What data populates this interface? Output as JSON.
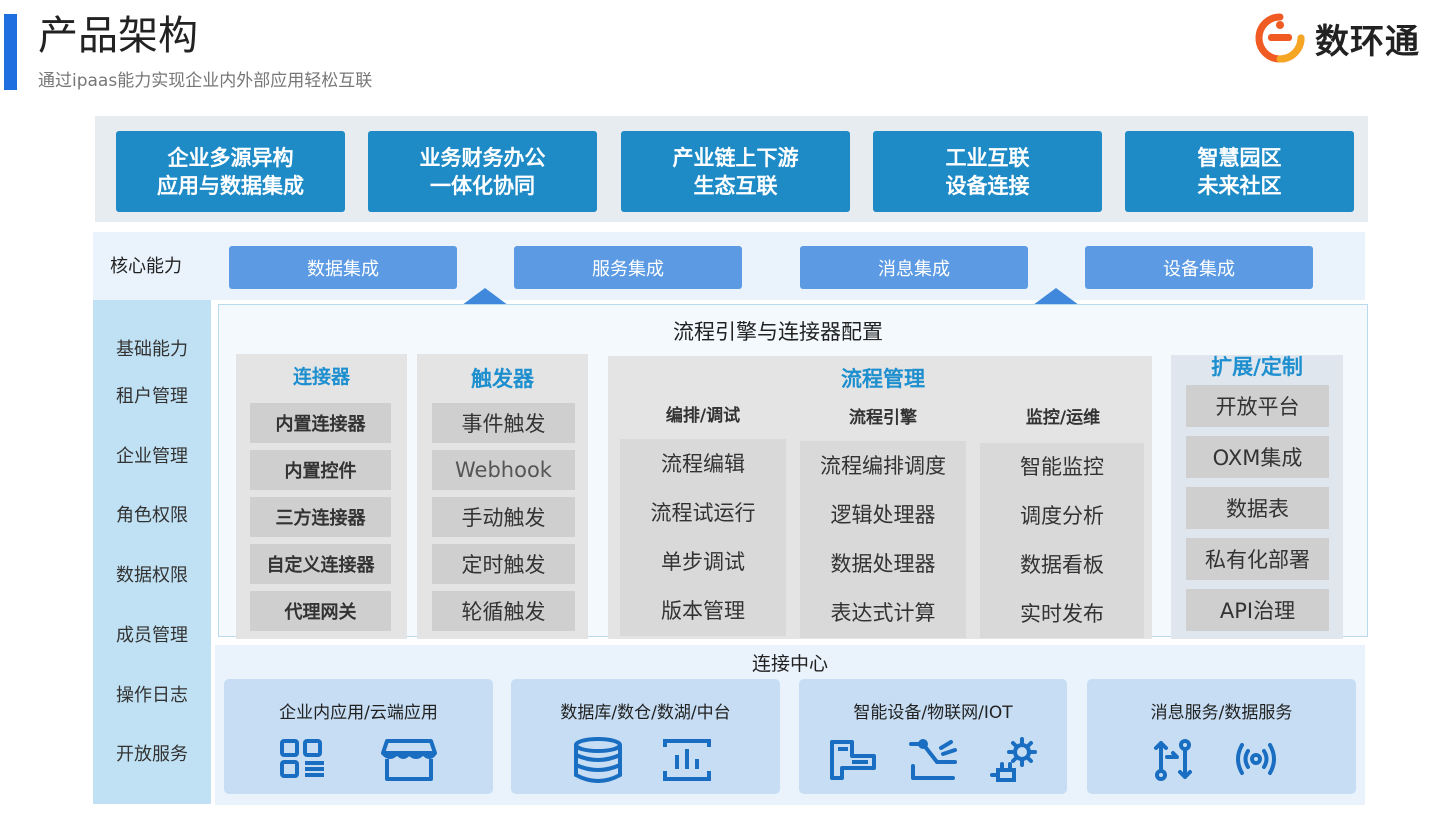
{
  "header": {
    "title": "产品架构",
    "subtitle": "通过ipaas能力实现企业内外部应用轻松互联",
    "logo_text": "数环通",
    "accent_color": "#1f6fe0"
  },
  "scenarios": [
    {
      "line1": "企业多源异构",
      "line2": "应用与数据集成"
    },
    {
      "line1": "业务财务办公",
      "line2": "一体化协同"
    },
    {
      "line1": "产业链上下游",
      "line2": "生态互联"
    },
    {
      "line1": "工业互联",
      "line2": "设备连接"
    },
    {
      "line1": "智慧园区",
      "line2": "未来社区"
    }
  ],
  "core": {
    "label": "核心能力",
    "items": [
      "数据集成",
      "服务集成",
      "消息集成",
      "设备集成"
    ]
  },
  "foundation": {
    "label": "基础能力",
    "items": [
      "租户管理",
      "企业管理",
      "角色权限",
      "数据权限",
      "成员管理",
      "操作日志",
      "开放服务"
    ]
  },
  "engine": {
    "title": "流程引擎与连接器配置",
    "connectors": {
      "title": "连接器",
      "items": [
        "内置连接器",
        "内置控件",
        "三方连接器",
        "自定义连接器",
        "代理网关"
      ]
    },
    "triggers": {
      "title": "触发器",
      "items": [
        "事件触发",
        "Webhook",
        "手动触发",
        "定时触发",
        "轮循触发"
      ]
    },
    "flow": {
      "title": "流程管理",
      "columns": [
        {
          "title": "编排/调试",
          "items": [
            "流程编辑",
            "流程试运行",
            "单步调试",
            "版本管理"
          ]
        },
        {
          "title": "流程引擎",
          "items": [
            "流程编排调度",
            "逻辑处理器",
            "数据处理器",
            "表达式计算"
          ]
        },
        {
          "title": "监控/运维",
          "items": [
            "智能监控",
            "调度分析",
            "数据看板",
            "实时发布"
          ]
        }
      ]
    },
    "extension": {
      "title": "扩展/定制",
      "items": [
        "开放平台",
        "OXM集成",
        "数据表",
        "私有化部署",
        "API治理"
      ]
    }
  },
  "connection_center": {
    "title": "连接中心",
    "cards": [
      {
        "label": "企业内应用/云端应用",
        "icons": [
          "app-grid-icon",
          "store-icon"
        ]
      },
      {
        "label": "数据库/数仓/数湖/中台",
        "icons": [
          "database-icon",
          "data-chart-icon"
        ]
      },
      {
        "label": "智能设备/物联网/IOT",
        "icons": [
          "printer-device-icon",
          "robot-arm-icon",
          "plug-gear-icon"
        ]
      },
      {
        "label": "消息服务/数据服务",
        "icons": [
          "sync-arrows-icon",
          "broadcast-icon"
        ]
      }
    ]
  },
  "colors": {
    "scenario": "#1e8bc7",
    "core_button": "#5c9be3",
    "panel_header": "#1d8fcf",
    "icon": "#1a6ec2",
    "sidebar": "#c0e1f3"
  }
}
